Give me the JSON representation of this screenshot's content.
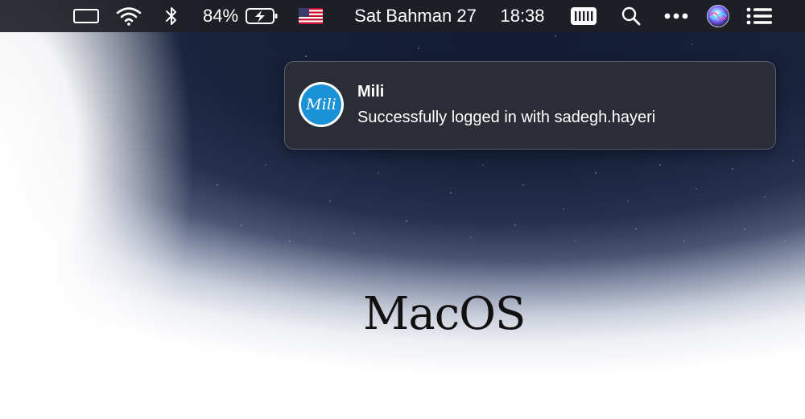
{
  "menubar": {
    "battery_percent": "84%",
    "date": "Sat Bahman 27",
    "time": "18:38",
    "icons": {
      "wifi": "wifi-icon",
      "bluetooth": "bluetooth-icon",
      "battery": "battery-charging-icon",
      "flag": "us-flag-icon",
      "keyboard": "keyboard-icon",
      "search": "spotlight-search-icon",
      "more": "more-icon",
      "siri": "siri-icon",
      "notifications": "notification-center-icon"
    }
  },
  "notification": {
    "app_name": "Mili",
    "icon_label": "Mili",
    "message": "Successfully logged in with sadegh.hayeri"
  },
  "wallpaper": {
    "logo_text": "MacOS"
  },
  "colors": {
    "menubar_bg": "#1e2026",
    "notification_bg": "#2c2e36",
    "app_icon_blue": "#1c92d6",
    "wallpaper_dark": "#131c33"
  }
}
